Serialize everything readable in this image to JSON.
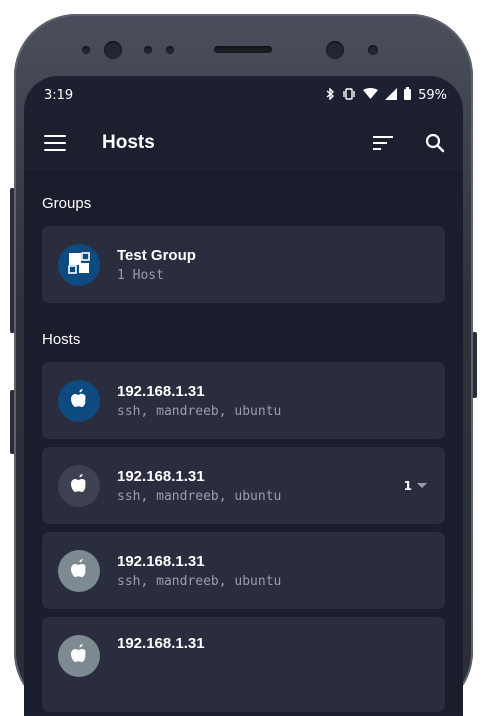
{
  "status": {
    "time": "3:19",
    "battery": "59%"
  },
  "appbar": {
    "title": "Hosts"
  },
  "sections": {
    "groups_title": "Groups",
    "hosts_title": "Hosts"
  },
  "groups": [
    {
      "name": "Test Group",
      "sub": "1 Host",
      "avatar_color": "#0d4a80"
    }
  ],
  "hosts": [
    {
      "name": "192.168.1.31",
      "sub": "ssh, mandreeb, ubuntu",
      "avatar_color": "#0d4a80",
      "icon": "apple-icon"
    },
    {
      "name": "192.168.1.31",
      "sub": "ssh, mandreeb, ubuntu",
      "avatar_color": "#3e4152",
      "icon": "apple-icon",
      "count": "1"
    },
    {
      "name": "192.168.1.31",
      "sub": "ssh, mandreeb, ubuntu",
      "avatar_color": "#7e8a92",
      "icon": "apple-icon"
    },
    {
      "name": "192.168.1.31",
      "sub": "",
      "avatar_color": "#7e8a92",
      "icon": "apple-icon"
    }
  ]
}
